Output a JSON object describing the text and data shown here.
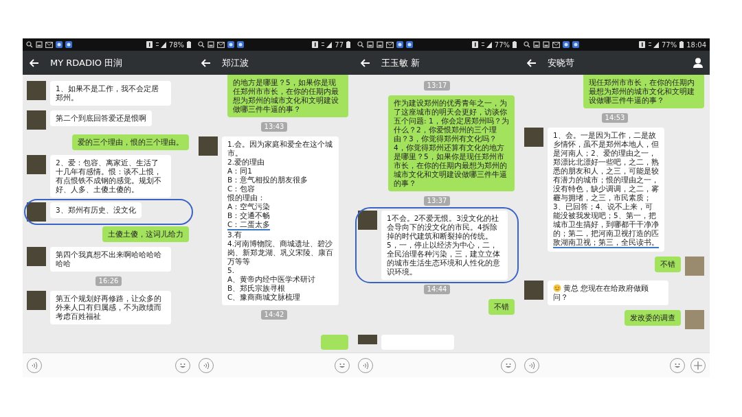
{
  "panels": [
    {
      "status_bar": {
        "icons": [
          {
            "kind": "search"
          },
          {
            "kind": "image"
          },
          {
            "kind": "mail"
          },
          {
            "kind": "app"
          },
          {
            "kind": "app"
          }
        ],
        "battery": "78%"
      },
      "title": "MY RDADIO 田润",
      "input_bar": {
        "plus_button": false
      },
      "messages": [
        {
          "kind": "in",
          "text": "1、如果不是工作，我不会定居郑州。"
        },
        {
          "kind": "in",
          "text": "第二个到底回答爱还是恨啊"
        },
        {
          "kind": "out",
          "avatar": false,
          "text": "爱的三个理由，恨的三个理由。"
        },
        {
          "kind": "in",
          "text": "2、爱：包容、离家近、生活了十几年有感情。恨：谈不上恨，有点恨铁不成钢的感觉。规划不好、人多、土傻土傻的。"
        },
        {
          "kind": "in",
          "circled": true,
          "text": "3、郑州有历史、没文化"
        },
        {
          "kind": "out",
          "avatar": false,
          "text": "土傻土傻，这词儿给力"
        },
        {
          "kind": "in",
          "text": "第四个我真想不出来啊哈哈哈哈哈哈"
        },
        {
          "kind": "time",
          "text": "16:26"
        },
        {
          "kind": "in",
          "text": "第五个规划好再修路，让众多的外来人口有归属感，不为政绩而考虑百姓福祉"
        }
      ]
    },
    {
      "status_bar": {
        "icons": [
          {
            "kind": "search"
          },
          {
            "kind": "image"
          },
          {
            "kind": "mail"
          },
          {
            "kind": "app"
          },
          {
            "kind": "app"
          }
        ],
        "battery": "77"
      },
      "title": "郑江波",
      "input_bar": {
        "plus_button": false
      },
      "messages": [
        {
          "kind": "out",
          "avatar": false,
          "cut_top": true,
          "text": "的地方是哪里？5，如果你是现任郑州市市长，在你的任期内最想为郑州的城市文化和文明建设做哪三件牛逼的事？"
        },
        {
          "kind": "time",
          "text": "13:43"
        },
        {
          "kind": "in",
          "lines": [
            {
              "text": "1.会。因为家庭和爱全在这个城"
            },
            {
              "text": "市。"
            },
            {
              "text": "2.爱的理由"
            },
            {
              "text": "A：同1"
            },
            {
              "text": "B：意气相投的朋友很多"
            },
            {
              "text": "C：包容"
            },
            {
              "text": "恨的理由："
            },
            {
              "text": "A：空气污染"
            },
            {
              "text": "B：交通不畅"
            },
            {
              "text": "C：二蛋太多",
              "underlined": true
            },
            {
              "text": "3.有"
            },
            {
              "text": "4.河南博物院、商城遗址、碧沙"
            },
            {
              "text": "岗、新郑龙湖、巩义宋陵、康百"
            },
            {
              "text": "万等等"
            },
            {
              "text": "5."
            },
            {
              "text": "A、黄帝内经中医学术研讨"
            },
            {
              "text": "B、郑氏宗族寻根"
            },
            {
              "text": "C、豫商商城文脉梳理"
            }
          ]
        },
        {
          "kind": "time",
          "text": "14:42"
        },
        {
          "kind": "partial_out"
        }
      ]
    },
    {
      "status_bar": {
        "icons": [
          {
            "kind": "search"
          },
          {
            "kind": "image"
          },
          {
            "kind": "image"
          },
          {
            "kind": "mail"
          },
          {
            "kind": "app"
          },
          {
            "kind": "app"
          }
        ],
        "battery": "77%"
      },
      "title": "王玉敏 新",
      "input_bar": {
        "plus_button": false
      },
      "messages": [
        {
          "kind": "time",
          "text": "13:17"
        },
        {
          "kind": "out",
          "avatar": false,
          "text": "作为建设郑州的优秀青年之一，为了这座城市的明天会更好，访谈你五个问题: 1，你会定居郑州吗？为什么？2，你爱恨郑州的三个理由？3，你觉得郑州有文化吗？ 4，你觉得郑州还算有文化的地方是哪里？5，如果你是现任郑州市市长，在你的任期内最想为郑州的城市文化和文明建设做哪三件牛逼的事？"
        },
        {
          "kind": "time",
          "text": "13:37"
        },
        {
          "kind": "in",
          "circled": true,
          "text": "1不会。2不爱无恨。3没文化的社会导向下的没文化的市民。4拆除掉的时代建筑和断裂掉的传统。5，一，停止以经济为中心，二，全民治理各种污染，三，建立立体的城市生活生态环境和人性化的意识环境。"
        },
        {
          "kind": "time",
          "text": "14:44"
        },
        {
          "kind": "out",
          "avatar": false,
          "text": "不错"
        },
        {
          "kind": "partial_in"
        }
      ]
    },
    {
      "status_bar": {
        "icons": [
          {
            "kind": "search"
          },
          {
            "kind": "image"
          },
          {
            "kind": "image"
          },
          {
            "kind": "mail"
          },
          {
            "kind": "app"
          },
          {
            "kind": "app"
          }
        ],
        "battery": "77%",
        "time": "18:04"
      },
      "title": "安晓苛",
      "contact_button": true,
      "input_bar": {
        "plus_button": true
      },
      "messages": [
        {
          "kind": "out",
          "avatar": false,
          "cut_top": true,
          "text": "现任郑州市市长，在你的任期内最想为郑州的城市文化和文明建设做哪三件牛逼的事？"
        },
        {
          "kind": "time",
          "text": "14:53"
        },
        {
          "kind": "in",
          "lines": [
            {
              "text": "1、会。一是因为工作，二是故"
            },
            {
              "text": "乡情怀，虽不是郑州本地人，但"
            },
            {
              "text": "是河南人；2、爱的理由之一，"
            },
            {
              "text": "郑漂比北漂好一些吧，之二，熟"
            },
            {
              "text": "悉的朋友和人，之三，可能是较"
            },
            {
              "text": "有潜力的城市；恨的理由之一，"
            },
            {
              "text": "没有特色，缺少调调，之二，雾"
            },
            {
              "text": "霾与拥堵，之三，市民素质；"
            },
            {
              "text": "3、已回答；4、说不上来，可"
            },
            {
              "text": "能没被我发现吧；5、第一，把"
            },
            {
              "text": "城市卫生搞好，到哪都干干净净"
            },
            {
              "text": "的；第二，把河南卫视打造的匹"
            },
            {
              "text": "敌湖南卫视；第三，全民读书。",
              "underlined": true
            }
          ]
        },
        {
          "kind": "out",
          "avatar": true,
          "text": "不错"
        },
        {
          "kind": "in",
          "emoji": true,
          "text": "黄总 您现在在给政府做顾问？"
        },
        {
          "kind": "out",
          "avatar": true,
          "text": "发改委的调查"
        }
      ]
    }
  ]
}
